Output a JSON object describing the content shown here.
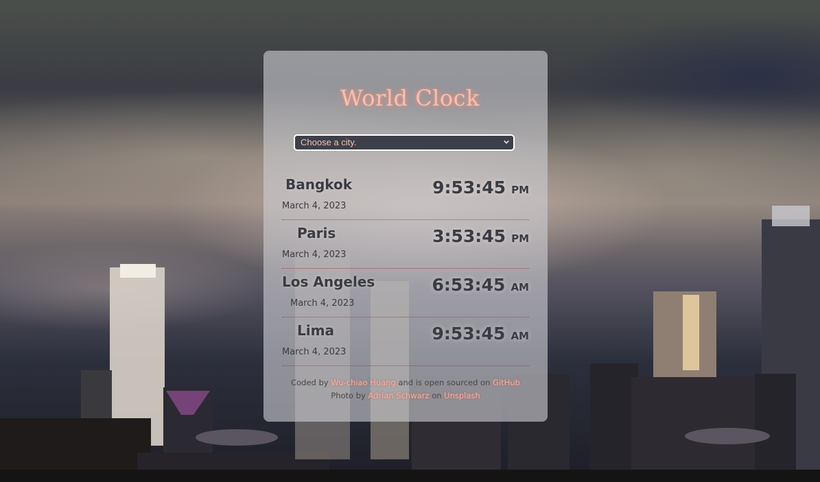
{
  "app": {
    "title": "World Clock"
  },
  "city_select": {
    "selected": "Choose a city."
  },
  "cities": [
    {
      "name": "Bangkok",
      "date": "March 4, 2023",
      "time": "9:53:45",
      "ampm": "PM"
    },
    {
      "name": "Paris",
      "date": "March 4, 2023",
      "time": "3:53:45",
      "ampm": "PM"
    },
    {
      "name": "Los Angeles",
      "date": "March 4, 2023",
      "time": "6:53:45",
      "ampm": "AM"
    },
    {
      "name": "Lima",
      "date": "March 4, 2023",
      "time": "9:53:45",
      "ampm": "AM"
    }
  ],
  "footer": {
    "coded_by": "Coded by",
    "author": "Wu-chiao Huang",
    "open_source_text": "and is open sourced on",
    "github": "GitHub",
    "photo_by": "Photo by",
    "photographer": "Adrian Schwarz",
    "on_text": "on",
    "unsplash": "Unsplash"
  },
  "colors": {
    "accent": "#f2c2b2",
    "text": "#3b3b42",
    "divider": "#a0474a"
  }
}
